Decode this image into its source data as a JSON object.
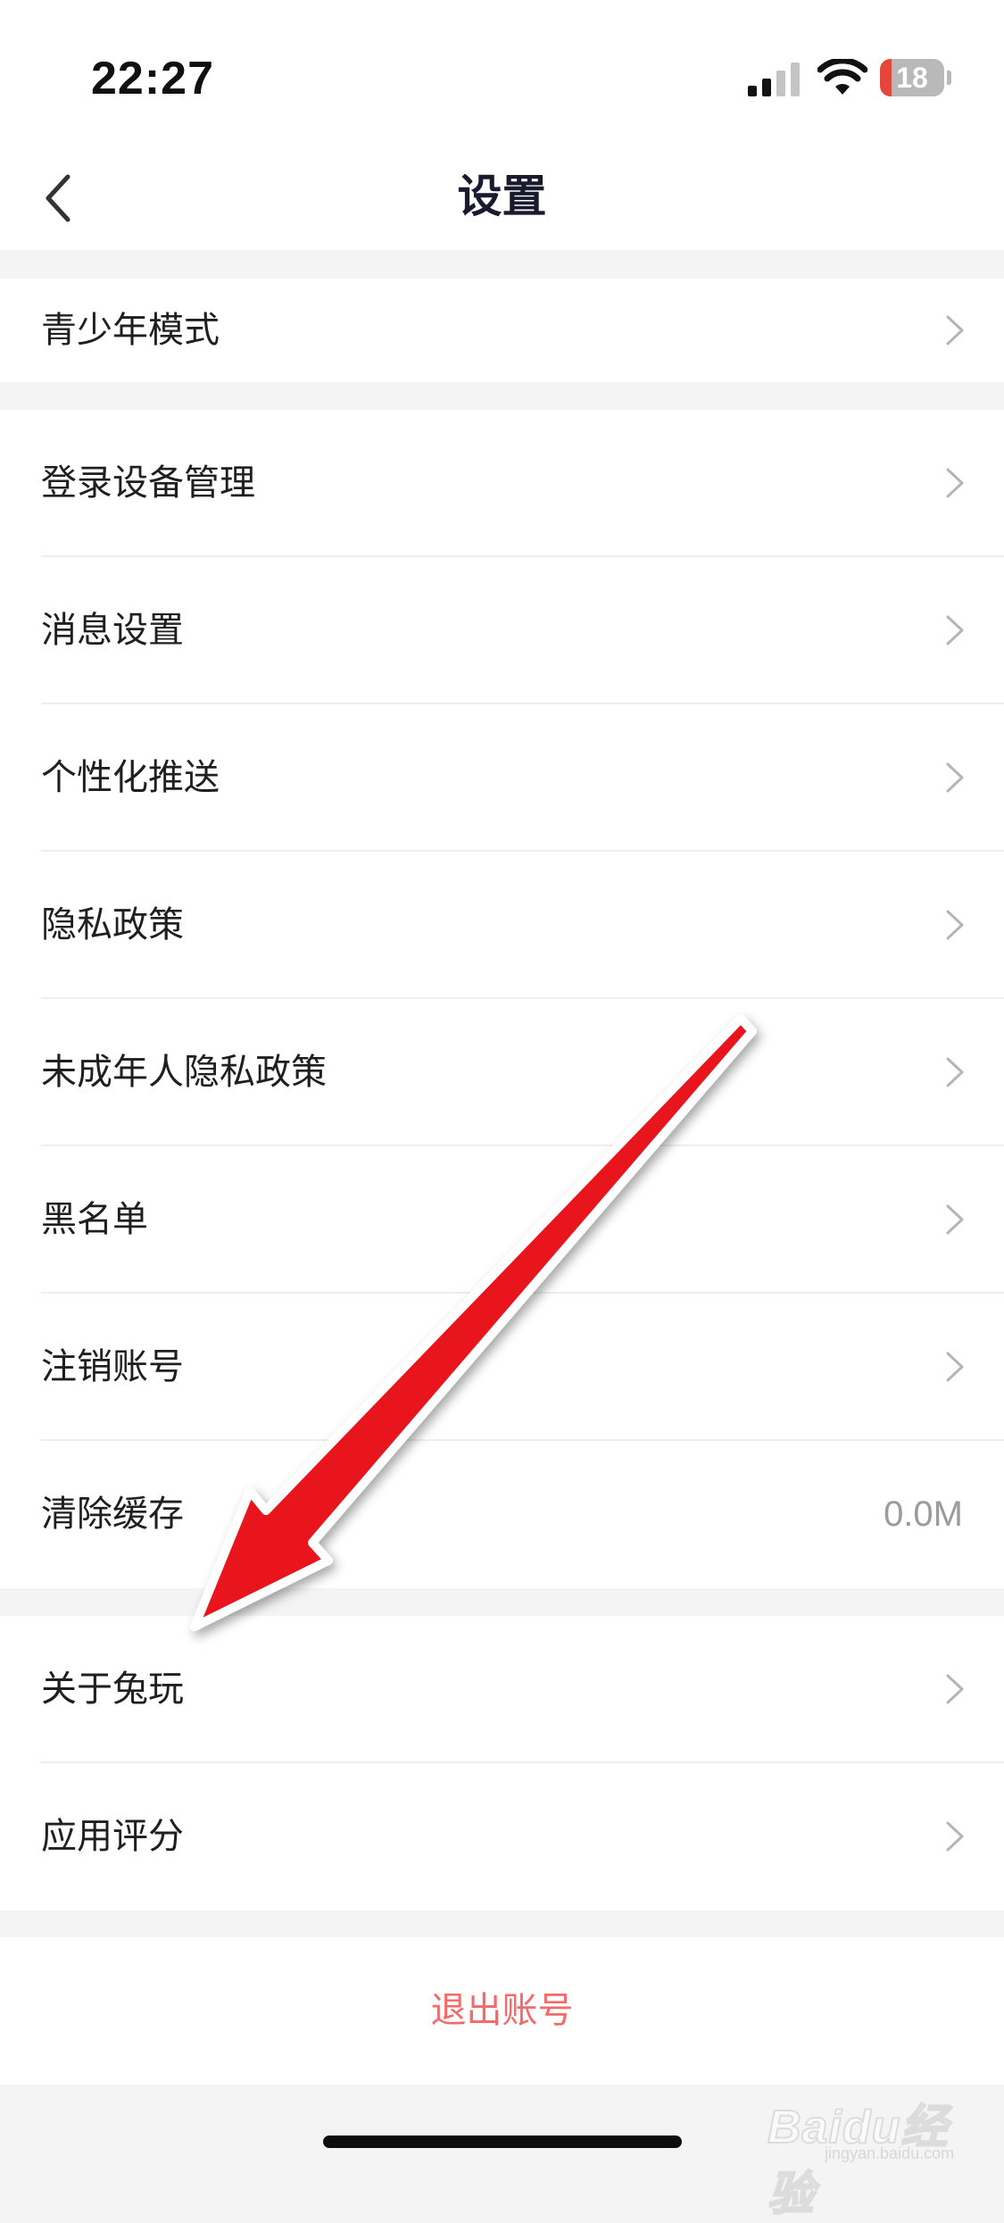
{
  "status_bar": {
    "time": "22:27",
    "battery_level": "18",
    "battery_fraction": 0.18,
    "icons": [
      "signal-icon",
      "wifi-icon",
      "battery-icon"
    ]
  },
  "header": {
    "title": "设置",
    "back_icon": "chevron-left-icon"
  },
  "groups": [
    {
      "items": [
        {
          "label": "青少年模式",
          "chevron": true
        }
      ]
    },
    {
      "items": [
        {
          "label": "登录设备管理",
          "chevron": true
        },
        {
          "label": "消息设置",
          "chevron": true
        },
        {
          "label": "个性化推送",
          "chevron": true
        },
        {
          "label": "隐私政策",
          "chevron": true
        },
        {
          "label": "未成年人隐私政策",
          "chevron": true
        },
        {
          "label": "黑名单",
          "chevron": true
        },
        {
          "label": "注销账号",
          "chevron": true
        },
        {
          "label": "清除缓存",
          "value": "0.0M"
        }
      ]
    },
    {
      "items": [
        {
          "label": "关于兔玩",
          "chevron": true
        },
        {
          "label": "应用评分",
          "chevron": true
        }
      ]
    }
  ],
  "logout": {
    "label": "退出账号"
  },
  "watermark": {
    "text": "Baidu经验",
    "sub": "jingyan.baidu.com"
  },
  "colors": {
    "accent_red": "#f26a6a",
    "arrow_red": "#e8141b",
    "battery_low": "#e5463a",
    "background": "#f4f4f4",
    "card": "#ffffff",
    "secondary_text": "#9b9b9b"
  }
}
